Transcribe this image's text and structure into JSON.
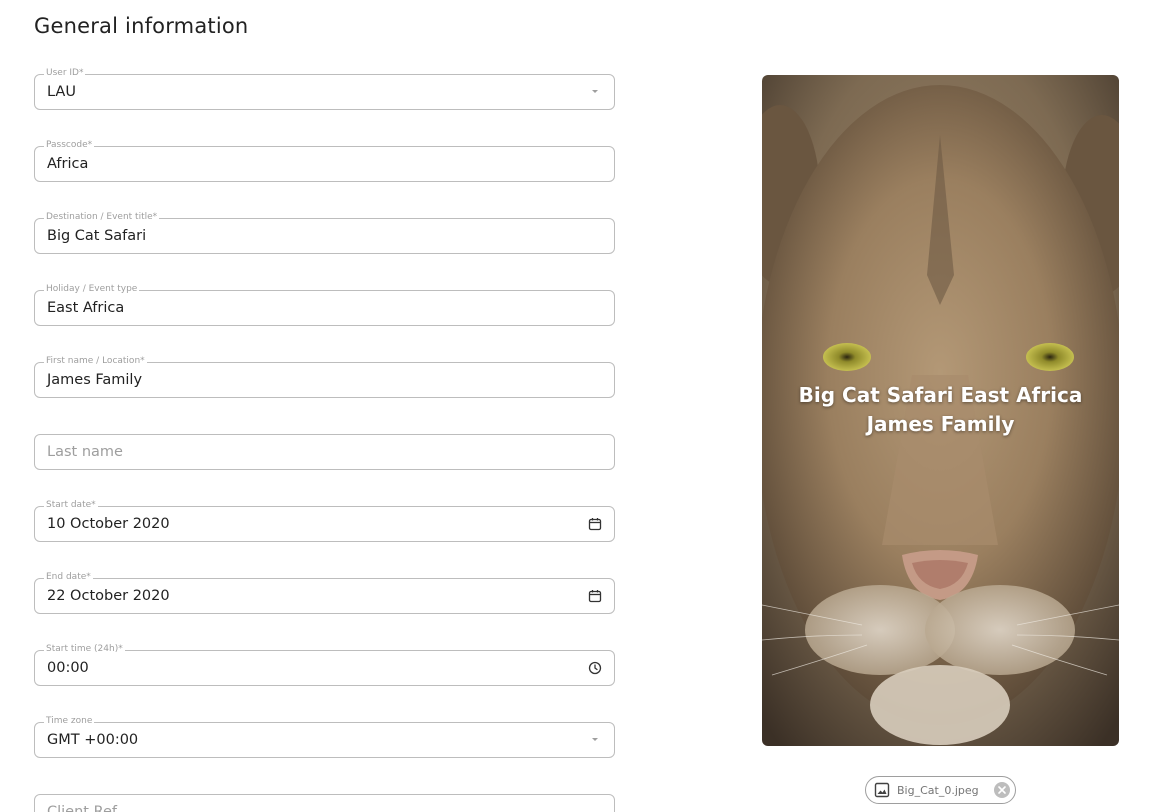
{
  "section": {
    "title": "General information"
  },
  "fields": {
    "user_id": {
      "label": "User ID*",
      "value": "LAU",
      "icon": "dropdown-arrow-icon"
    },
    "passcode": {
      "label": "Passcode*",
      "value": "Africa"
    },
    "destination": {
      "label": "Destination / Event title*",
      "value": "Big Cat Safari"
    },
    "holiday_type": {
      "label": "Holiday / Event type",
      "value": "East Africa"
    },
    "first_name": {
      "label": "First name / Location*",
      "value": "James Family"
    },
    "last_name": {
      "placeholder": "Last name"
    },
    "start_date": {
      "label": "Start date*",
      "value": "10 October 2020",
      "icon": "calendar-icon"
    },
    "end_date": {
      "label": "End date*",
      "value": "22 October 2020",
      "icon": "calendar-icon"
    },
    "start_time": {
      "label": "Start time (24h)*",
      "value": "00:00",
      "icon": "clock-icon"
    },
    "time_zone": {
      "label": "Time zone",
      "value": "GMT +00:00",
      "icon": "dropdown-arrow-icon"
    },
    "client_ref": {
      "placeholder": "Client Ref"
    }
  },
  "preview": {
    "overlay_line1": "Big Cat Safari East Africa",
    "overlay_line2": "James Family",
    "image_subject": "lion-face-photo"
  },
  "attachment": {
    "filename": "Big_Cat_0.jpeg",
    "icon": "image-icon",
    "remove_icon": "remove-circle-icon"
  }
}
